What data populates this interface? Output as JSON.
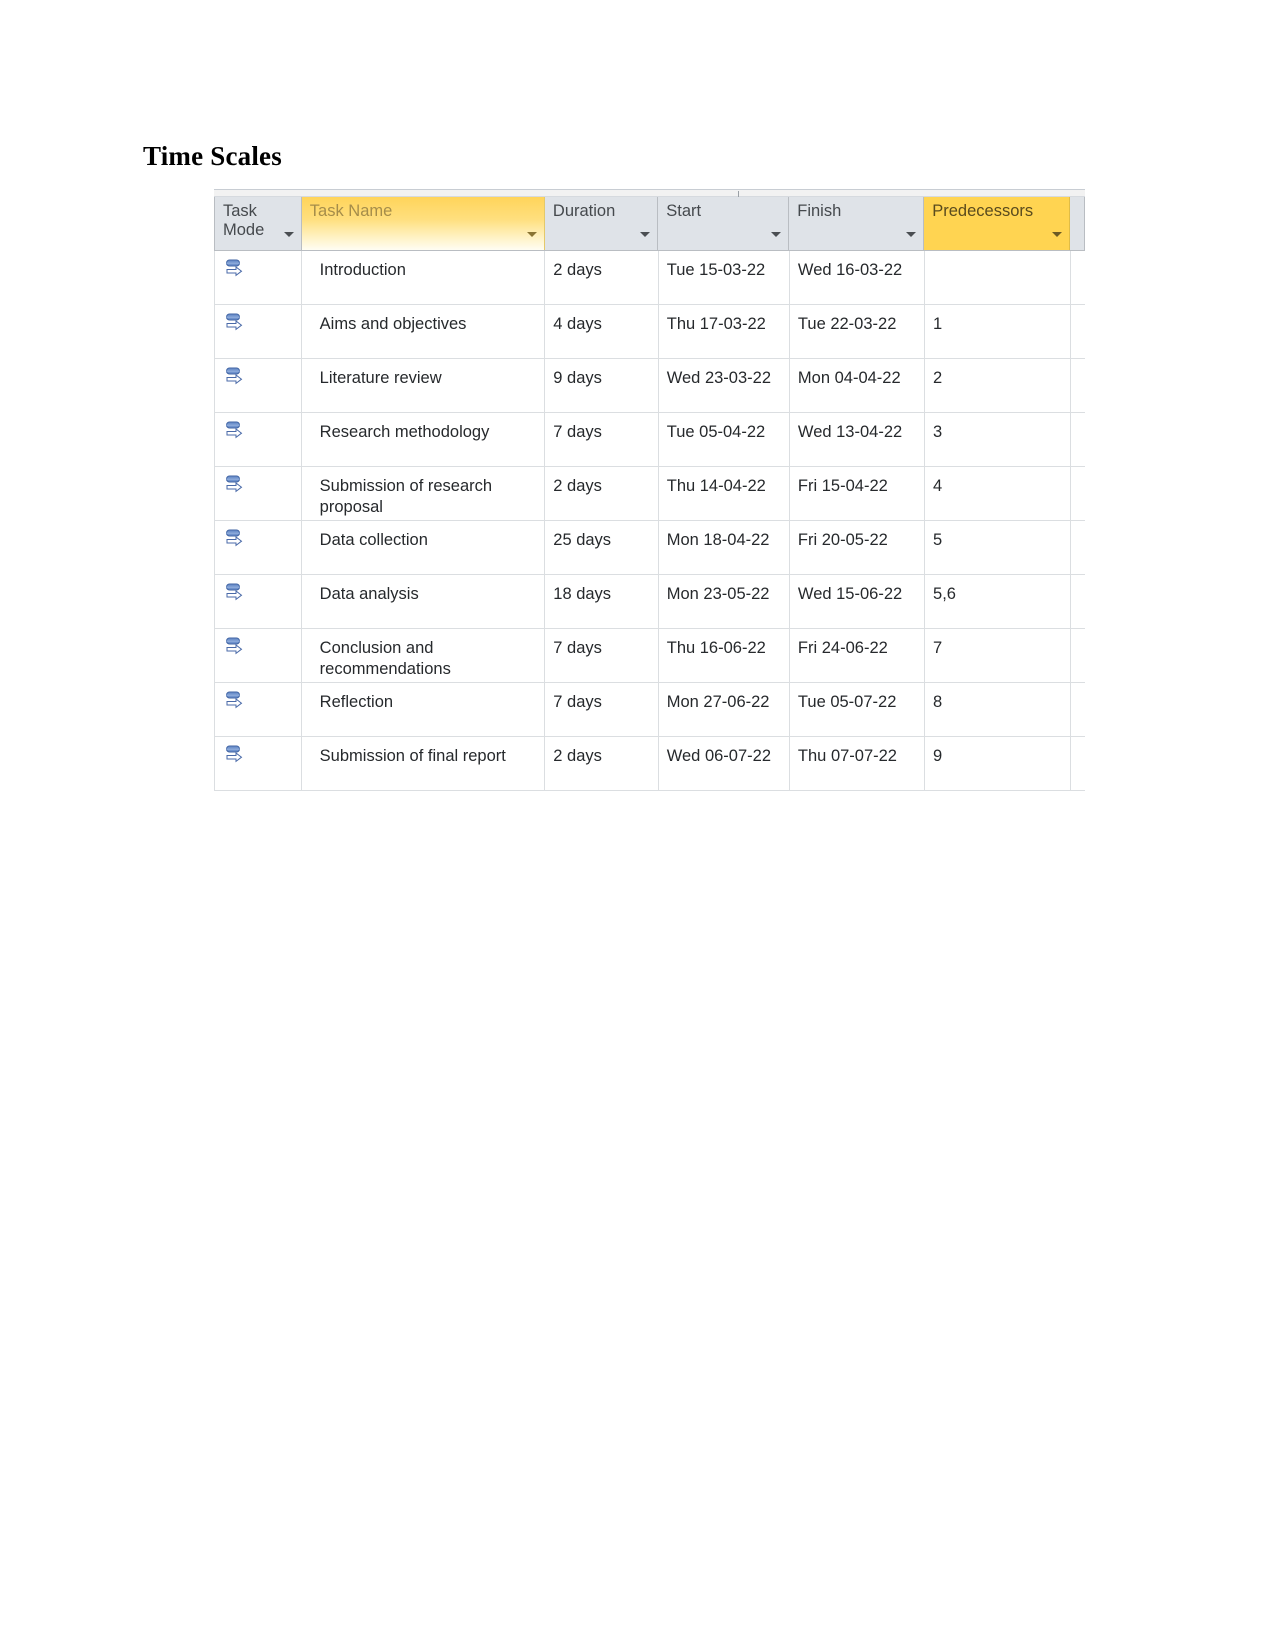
{
  "document": {
    "heading": "Time Scales"
  },
  "grid": {
    "columns": [
      {
        "key": "mode",
        "label": "Task\nMode",
        "style": "plain",
        "has_filter_arrow": true
      },
      {
        "key": "name",
        "label": "Task Name",
        "style": "gradient-yellow",
        "has_filter_arrow": true
      },
      {
        "key": "dur",
        "label": "Duration",
        "style": "plain",
        "has_filter_arrow": true
      },
      {
        "key": "start",
        "label": "Start",
        "style": "plain",
        "has_filter_arrow": true
      },
      {
        "key": "finish",
        "label": "Finish",
        "style": "plain",
        "has_filter_arrow": true
      },
      {
        "key": "pred",
        "label": "Predecessors",
        "style": "solid-yellow",
        "has_filter_arrow": true
      }
    ],
    "header": {
      "task_mode_line1": "Task",
      "task_mode_line2": "Mode",
      "task_name": "Task Name",
      "duration": "Duration",
      "start": "Start",
      "finish": "Finish",
      "predecessors": "Predecessors"
    },
    "task_mode_icon": "auto-scheduled-icon",
    "rows": [
      {
        "mode_icon": "auto-scheduled-icon",
        "name": "Introduction",
        "duration": "2 days",
        "start": "Tue 15-03-22",
        "finish": "Wed 16-03-22",
        "predecessors": ""
      },
      {
        "mode_icon": "auto-scheduled-icon",
        "name": "Aims and objectives",
        "duration": "4 days",
        "start": "Thu 17-03-22",
        "finish": "Tue 22-03-22",
        "predecessors": "1"
      },
      {
        "mode_icon": "auto-scheduled-icon",
        "name": "Literature review",
        "duration": "9 days",
        "start": "Wed 23-03-22",
        "finish": "Mon 04-04-22",
        "predecessors": "2"
      },
      {
        "mode_icon": "auto-scheduled-icon",
        "name": "Research methodology",
        "duration": "7 days",
        "start": "Tue 05-04-22",
        "finish": "Wed 13-04-22",
        "predecessors": "3"
      },
      {
        "mode_icon": "auto-scheduled-icon",
        "name": "Submission of research proposal",
        "duration": "2 days",
        "start": "Thu 14-04-22",
        "finish": "Fri 15-04-22",
        "predecessors": "4"
      },
      {
        "mode_icon": "auto-scheduled-icon",
        "name": "Data collection",
        "duration": "25 days",
        "start": "Mon 18-04-22",
        "finish": "Fri 20-05-22",
        "predecessors": "5"
      },
      {
        "mode_icon": "auto-scheduled-icon",
        "name": "Data analysis",
        "duration": "18 days",
        "start": "Mon 23-05-22",
        "finish": "Wed 15-06-22",
        "predecessors": "5,6"
      },
      {
        "mode_icon": "auto-scheduled-icon",
        "name": "Conclusion and recommendations",
        "duration": "7 days",
        "start": "Thu 16-06-22",
        "finish": "Fri 24-06-22",
        "predecessors": "7"
      },
      {
        "mode_icon": "auto-scheduled-icon",
        "name": "Reflection",
        "duration": "7 days",
        "start": "Mon 27-06-22",
        "finish": "Tue 05-07-22",
        "predecessors": "8"
      },
      {
        "mode_icon": "auto-scheduled-icon",
        "name": "Submission of final report",
        "duration": "2 days",
        "start": "Wed 06-07-22",
        "finish": "Thu 07-07-22",
        "predecessors": "9"
      }
    ]
  },
  "colors": {
    "header_plain_bg": "#dfe3e8",
    "header_taskname_top": "#ffd45a",
    "header_predecessors_bg": "#ffd451",
    "grid_line": "#dbdee1",
    "text": "#26292c",
    "icon_blue": "#5b7fc0"
  }
}
